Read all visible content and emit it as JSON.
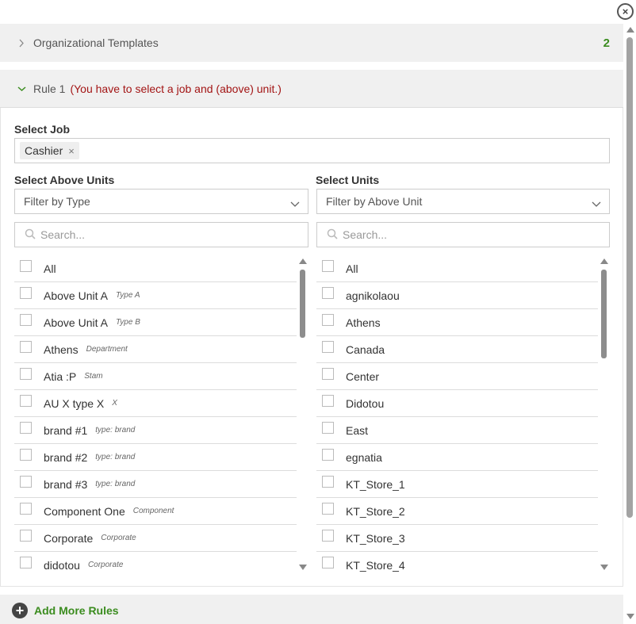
{
  "close_label": "×",
  "org_templates": {
    "label": "Organizational Templates",
    "count": "2"
  },
  "rule": {
    "title": "Rule 1",
    "warning": "(You have to select a job and (above) unit.)"
  },
  "select_job": {
    "label": "Select Job",
    "tag": "Cashier",
    "tag_remove": "×"
  },
  "above_units": {
    "label": "Select Above Units",
    "filter_placeholder": "Filter by Type",
    "search_placeholder": "Search...",
    "items": [
      {
        "label": "All",
        "meta": ""
      },
      {
        "label": "Above Unit A",
        "meta": "Type A"
      },
      {
        "label": "Above Unit A",
        "meta": "Type B"
      },
      {
        "label": "Athens",
        "meta": "Department"
      },
      {
        "label": "Atia :P",
        "meta": "Stam"
      },
      {
        "label": "AU X type X",
        "meta": "X"
      },
      {
        "label": "brand #1",
        "meta": "type: brand"
      },
      {
        "label": "brand #2",
        "meta": "type: brand"
      },
      {
        "label": "brand #3",
        "meta": "type: brand"
      },
      {
        "label": "Component One",
        "meta": "Component"
      },
      {
        "label": "Corporate",
        "meta": "Corporate"
      },
      {
        "label": "didotou",
        "meta": "Corporate"
      }
    ]
  },
  "units": {
    "label": "Select Units",
    "filter_placeholder": "Filter by Above Unit",
    "search_placeholder": "Search...",
    "items": [
      {
        "label": "All"
      },
      {
        "label": "agnikolaou"
      },
      {
        "label": "Athens"
      },
      {
        "label": "Canada"
      },
      {
        "label": "Center"
      },
      {
        "label": "Didotou"
      },
      {
        "label": "East"
      },
      {
        "label": "egnatia"
      },
      {
        "label": "KT_Store_1"
      },
      {
        "label": "KT_Store_2"
      },
      {
        "label": "KT_Store_3"
      },
      {
        "label": "KT_Store_4"
      }
    ]
  },
  "add_more": {
    "label": "Add More Rules",
    "icon": "plus-circle-icon"
  },
  "colors": {
    "accent_green": "#3b8c1f",
    "warning_red": "#a31515",
    "header_bg": "#f0f0f0"
  }
}
